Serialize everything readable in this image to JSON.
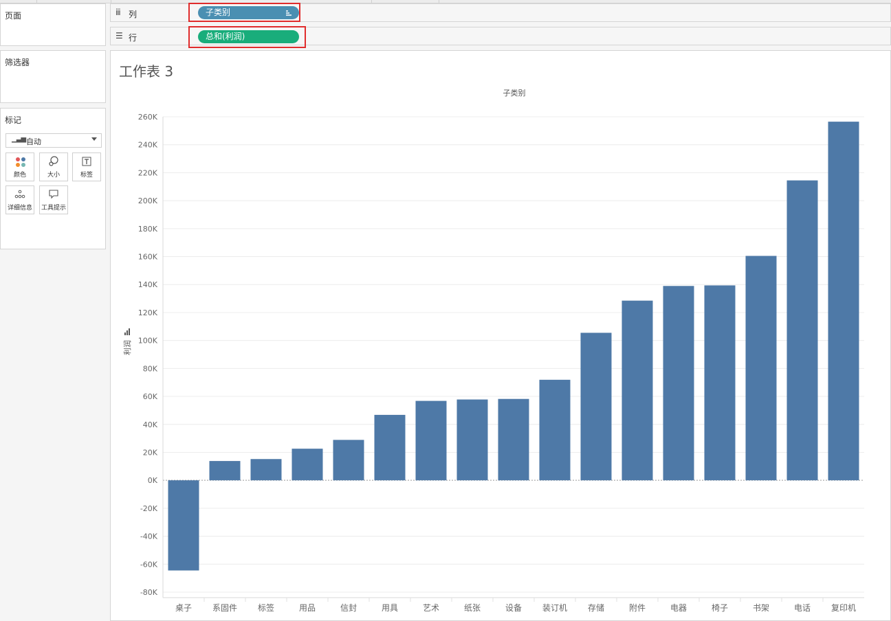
{
  "panels": {
    "pages": {
      "title": "页面"
    },
    "filters": {
      "title": "筛选器"
    },
    "marks": {
      "title": "标记",
      "mark_type": "自动",
      "cards": [
        {
          "label": "颜色",
          "icon": "color-dots-icon"
        },
        {
          "label": "大小",
          "icon": "size-icon"
        },
        {
          "label": "标签",
          "icon": "text-label-icon"
        },
        {
          "label": "详细信息",
          "icon": "detail-dots-icon"
        },
        {
          "label": "工具提示",
          "icon": "tooltip-icon"
        }
      ]
    }
  },
  "shelves": {
    "columns": {
      "label": "列",
      "pill": "子类别",
      "pill_color": "#4a8fb2",
      "icon": "columns-icon"
    },
    "rows": {
      "label": "行",
      "pill": "总和(利润)",
      "pill_color": "#19ad7b",
      "icon": "rows-icon"
    }
  },
  "highlight_color": "#e02b2b",
  "sheet": {
    "title": "工作表 3"
  },
  "chart_data": {
    "type": "bar",
    "title": "子类别",
    "xlabel": "",
    "ylabel": "利润",
    "bar_color": "#4e79a7",
    "categories": [
      "桌子",
      "系固件",
      "标签",
      "用品",
      "信封",
      "用具",
      "艺术",
      "纸张",
      "设备",
      "装订机",
      "存储",
      "附件",
      "电器",
      "椅子",
      "书架",
      "电话",
      "复印机"
    ],
    "values": [
      -64500,
      13800,
      15200,
      22600,
      28900,
      46800,
      56800,
      57800,
      58200,
      71900,
      105500,
      128500,
      139000,
      139400,
      160500,
      214500,
      256500
    ],
    "ylim": [
      -80000,
      260000
    ],
    "yticks": [
      260000,
      240000,
      220000,
      200000,
      180000,
      160000,
      140000,
      120000,
      100000,
      80000,
      60000,
      40000,
      20000,
      0,
      -20000,
      -40000,
      -60000,
      -80000
    ],
    "ytick_labels": [
      "260K",
      "240K",
      "220K",
      "200K",
      "180K",
      "160K",
      "140K",
      "120K",
      "100K",
      "80K",
      "60K",
      "40K",
      "20K",
      "0K",
      "-20K",
      "-40K",
      "-60K",
      "-80K"
    ],
    "grid": true
  }
}
